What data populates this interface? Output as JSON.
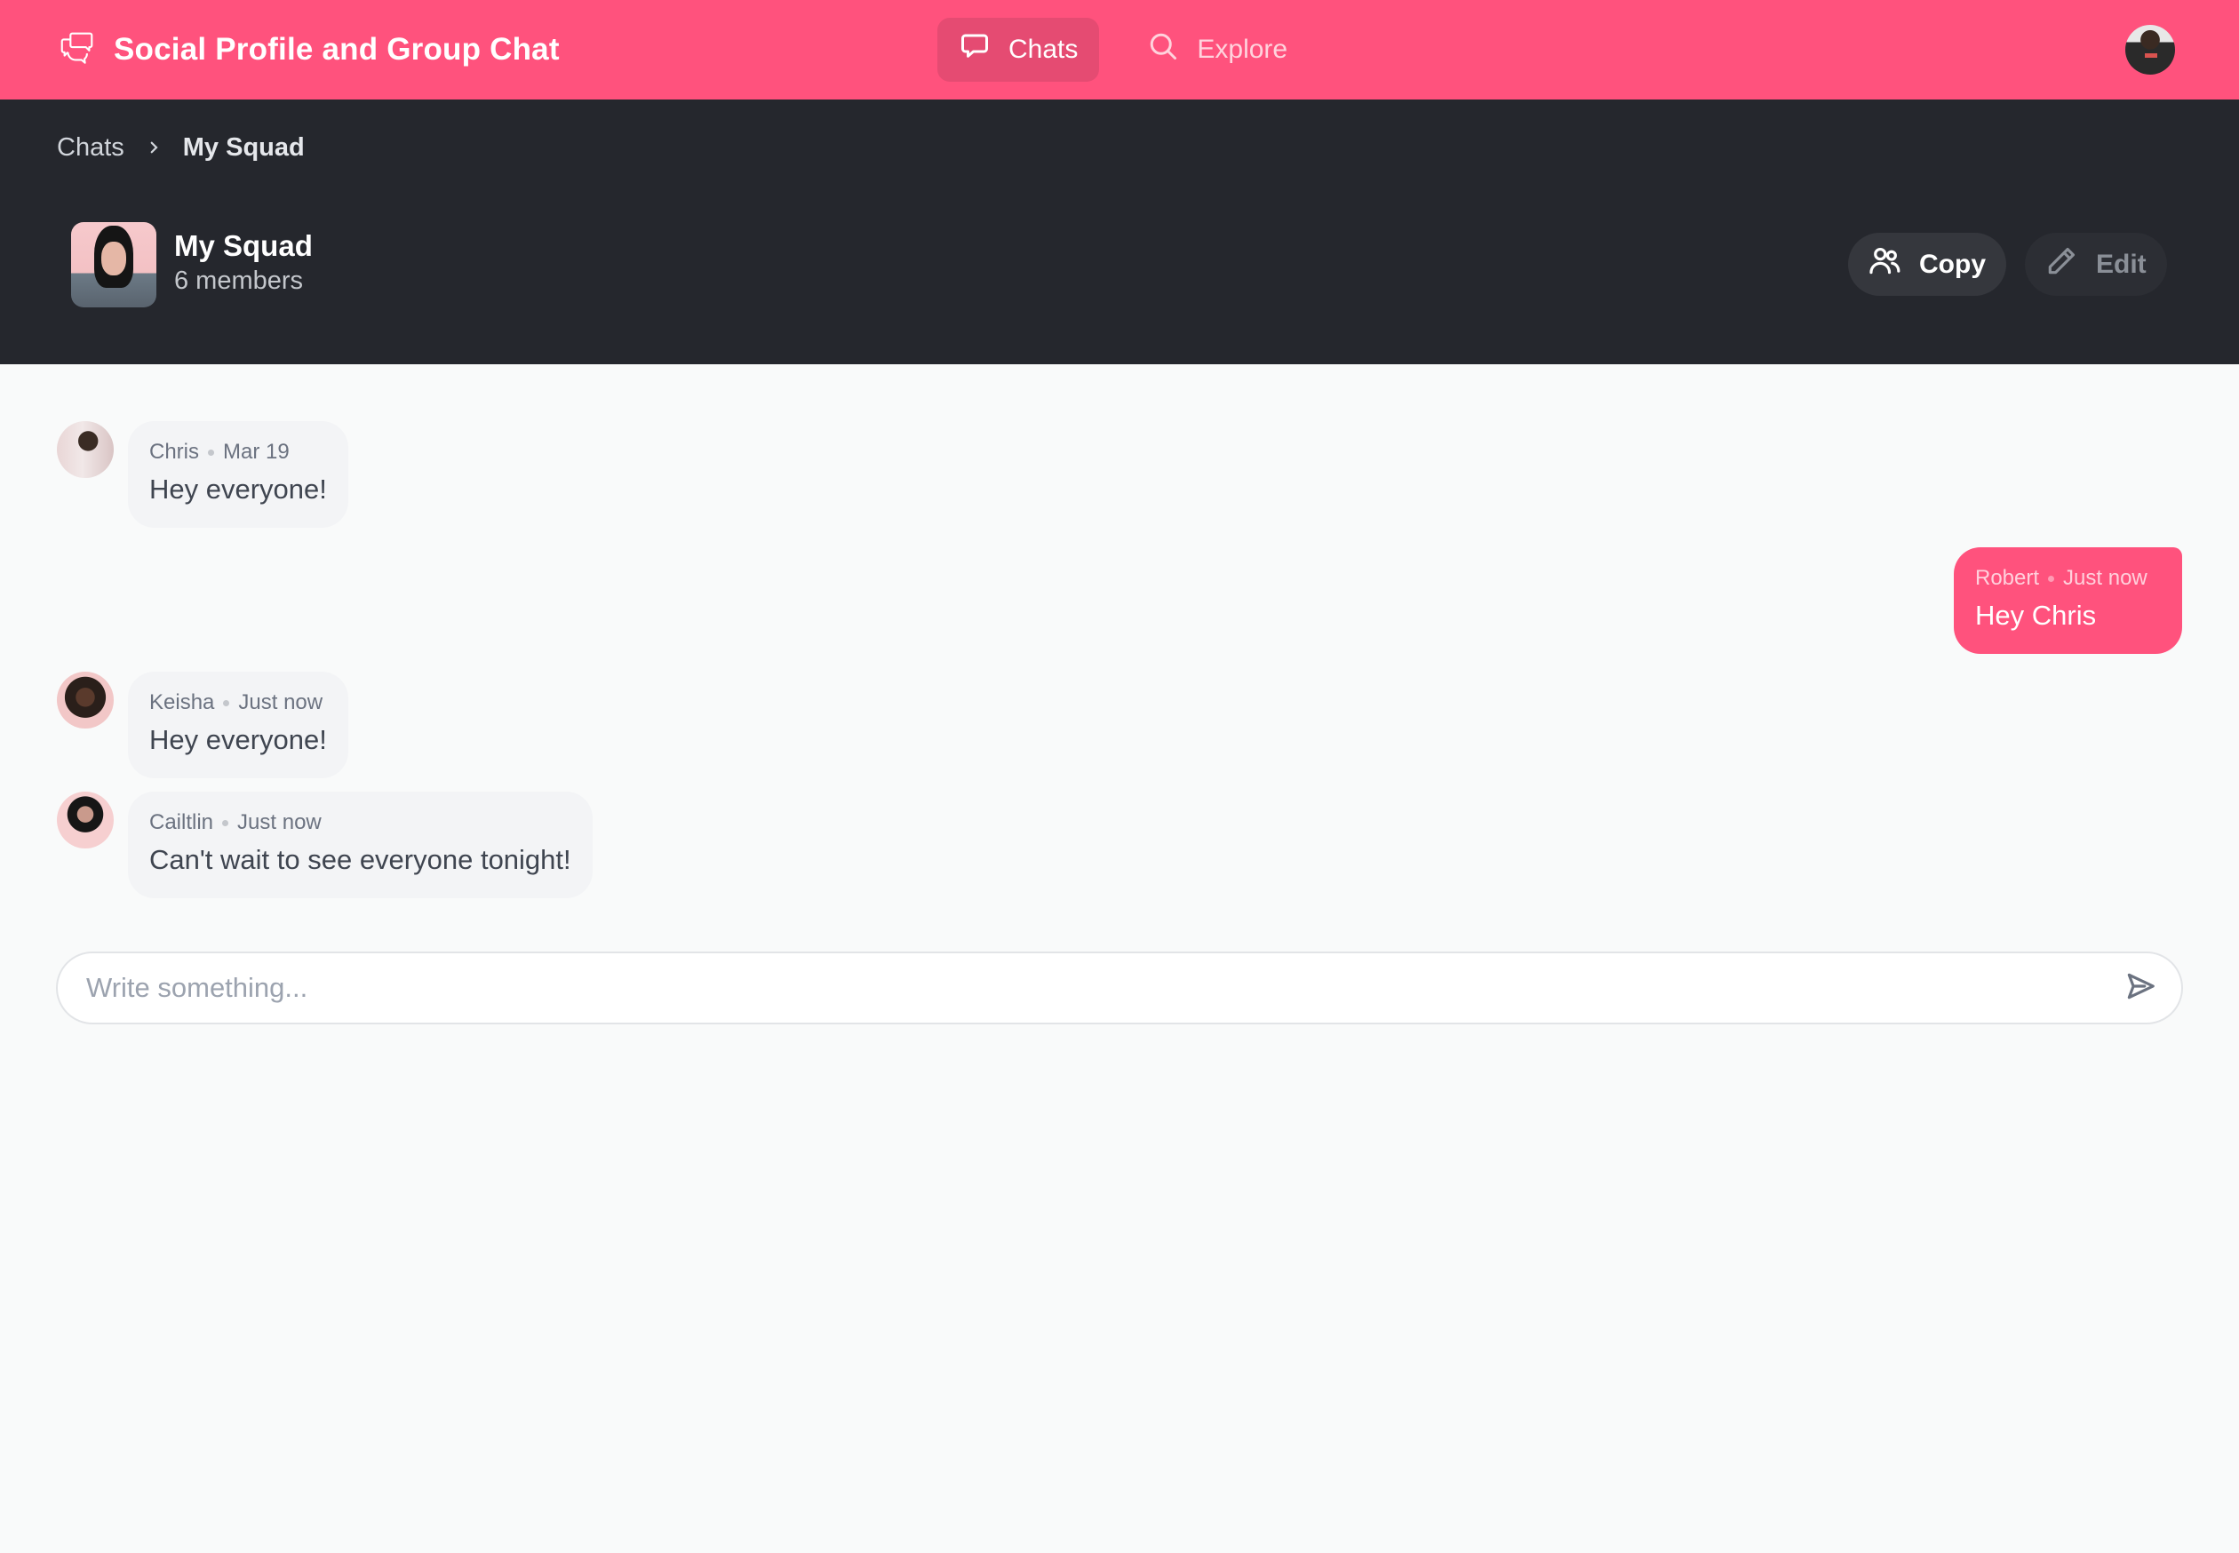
{
  "app": {
    "title": "Social Profile and Group Chat",
    "logo_icon": "chat-bubbles-icon",
    "colors": {
      "brand": "#ff527d",
      "header_dark": "#25272d",
      "background": "#f9fafa"
    }
  },
  "nav": {
    "items": [
      {
        "label": "Chats",
        "icon": "chat-bubble-icon",
        "active": true
      },
      {
        "label": "Explore",
        "icon": "search-icon",
        "active": false
      }
    ],
    "user_avatar": "user-avatar"
  },
  "breadcrumb": {
    "parent": "Chats",
    "separator_icon": "chevron-right-icon",
    "current": "My Squad"
  },
  "group": {
    "name": "My Squad",
    "members": "6 members",
    "actions": {
      "copy_label": "Copy",
      "copy_icon": "users-icon",
      "edit_label": "Edit",
      "edit_icon": "pencil-icon"
    }
  },
  "messages": [
    {
      "author": "Chris",
      "time": "Mar 19",
      "text": "Hey everyone!",
      "mine": false
    },
    {
      "author": "Robert",
      "time": "Just now",
      "text": "Hey Chris",
      "mine": true
    },
    {
      "author": "Keisha",
      "time": "Just now",
      "text": "Hey everyone!",
      "mine": false
    },
    {
      "author": "Cailtlin",
      "time": "Just now",
      "text": "Can't wait to see everyone tonight!",
      "mine": false
    }
  ],
  "composer": {
    "placeholder": "Write something...",
    "value": "",
    "send_icon": "send-icon"
  }
}
